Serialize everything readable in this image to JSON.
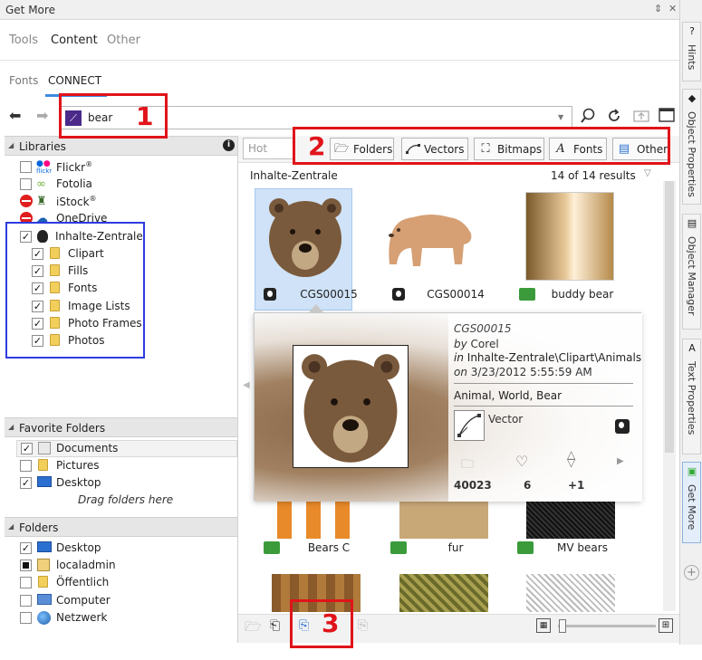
{
  "window": {
    "title": "Get More",
    "pin_glyph": "⇕",
    "close_glyph": "✕"
  },
  "main_tabs": [
    {
      "label": "Tools",
      "active": false
    },
    {
      "label": "Content",
      "active": true
    },
    {
      "label": "Other",
      "active": false
    }
  ],
  "sub_tabs": [
    {
      "label": "Fonts",
      "active": false
    },
    {
      "label": "CONNECT",
      "active": true
    }
  ],
  "toolbar": {
    "search_value": "bear",
    "back_icon": "arrow-left-icon",
    "forward_icon": "arrow-right-icon",
    "search_icon": "magnifier-icon",
    "refresh_icon": "refresh-icon"
  },
  "libraries": {
    "header": "Libraries",
    "items": [
      {
        "label": "Flickr",
        "sup": "®",
        "checked": false,
        "icon": "flickr-icon"
      },
      {
        "label": "Fotolia",
        "sup": "",
        "checked": false,
        "icon": "fotolia-icon"
      },
      {
        "label": "iStock",
        "sup": "®",
        "checked": false,
        "icon": "istock-icon",
        "blocked": true
      },
      {
        "label": "OneDrive",
        "sup": "",
        "checked": false,
        "icon": "onedrive-icon",
        "blocked": true
      },
      {
        "label": "Inhalte-Zentrale",
        "sup": "",
        "checked": true,
        "icon": "balloon-icon"
      }
    ],
    "children": [
      "Clipart",
      "Fills",
      "Fonts",
      "Image Lists",
      "Photo Frames",
      "Photos"
    ]
  },
  "favorites": {
    "header": "Favorite Folders",
    "items": [
      {
        "label": "Documents",
        "checked": true
      },
      {
        "label": "Pictures",
        "checked": false
      },
      {
        "label": "Desktop",
        "checked": true
      }
    ],
    "hint": "Drag folders here"
  },
  "folders": {
    "header": "Folders",
    "items": [
      {
        "label": "Desktop",
        "checked": true
      },
      {
        "label": "localadmin",
        "checked": "partial"
      },
      {
        "label": "Öffentlich",
        "checked": false
      },
      {
        "label": "Computer",
        "checked": false
      },
      {
        "label": "Netzwerk",
        "checked": false
      }
    ]
  },
  "filter": {
    "placeholder": "Hot",
    "buttons": [
      "Folders",
      "Vectors",
      "Bitmaps",
      "Fonts",
      "Other"
    ]
  },
  "results": {
    "location": "Inhalte-Zentrale",
    "count": "14 of 14 results",
    "items": [
      {
        "label": "CGS00015"
      },
      {
        "label": "CGS00014"
      },
      {
        "label": "buddy bear"
      },
      {
        "label": "Bears C"
      },
      {
        "label": "fur"
      },
      {
        "label": "MV bears"
      }
    ]
  },
  "popup": {
    "name": "CGS00015",
    "by_prefix": "by",
    "author": "Corel",
    "in_prefix": "in",
    "path": "Inhalte-Zentrale\\Clipart\\Animals",
    "on_prefix": "on",
    "date": "3/23/2012 5:55:59 AM",
    "tags": "Animal, World, Bear",
    "type": "Vector",
    "downloads": "40023",
    "likes": "6",
    "votes": "+1"
  },
  "annotations": [
    "1",
    "2",
    "3"
  ],
  "dock_tabs": [
    "Hints",
    "Object Properties",
    "Object Manager",
    "Text Properties",
    "Get More"
  ],
  "colors": {
    "accent": "#3d8be0",
    "highlight_red": "#e0141a",
    "highlight_blue": "#2e3be0"
  }
}
